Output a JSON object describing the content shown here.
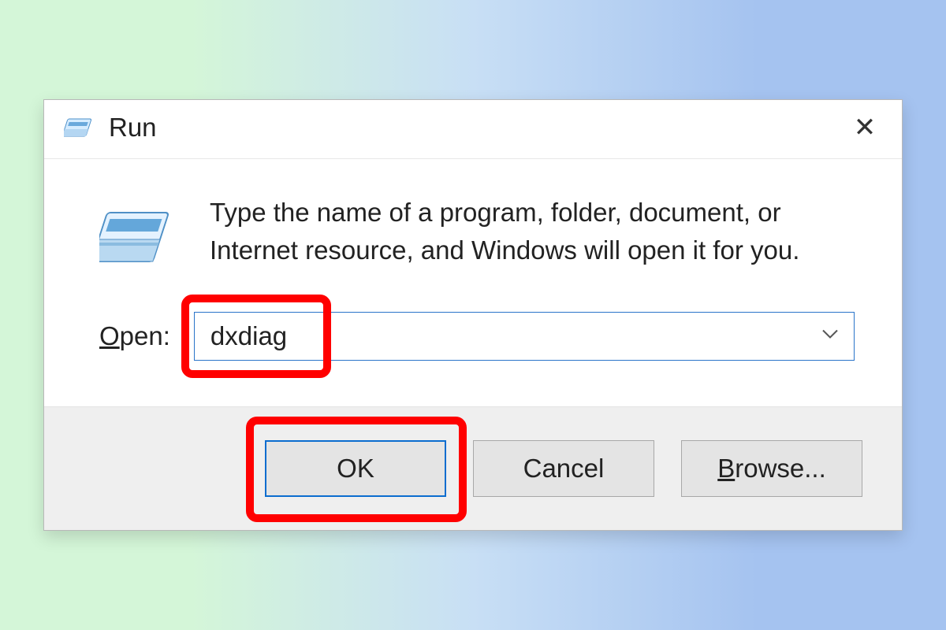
{
  "titlebar": {
    "title": "Run",
    "close_glyph": "✕"
  },
  "body": {
    "description": "Type the name of a program, folder, document, or Internet resource, and Windows will open it for you.",
    "open_label_pre": "O",
    "open_label_rest": "pen:",
    "input_value": "dxdiag"
  },
  "buttons": {
    "ok": "OK",
    "cancel": "Cancel",
    "browse_pre": "B",
    "browse_rest": "rowse..."
  }
}
